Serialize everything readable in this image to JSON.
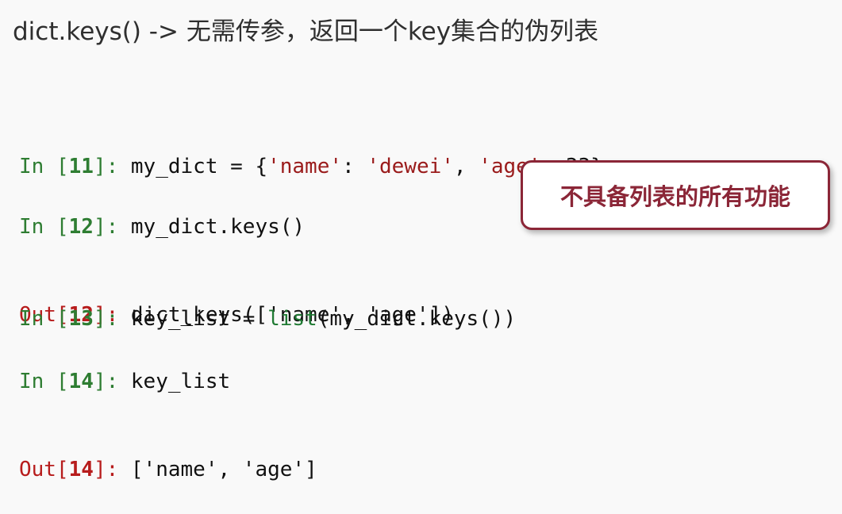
{
  "slide": {
    "title": "dict.keys()  -> 无需传参，返回一个key集合的伪列表"
  },
  "cells": [
    {
      "in_label": "In [",
      "in_num": "11",
      "in_close": "]: ",
      "code": [
        {
          "text": "my_dict = {",
          "kind": "txt"
        },
        {
          "text": "'name'",
          "kind": "str"
        },
        {
          "text": ": ",
          "kind": "txt"
        },
        {
          "text": "'dewei'",
          "kind": "str"
        },
        {
          "text": ", ",
          "kind": "txt"
        },
        {
          "text": "'age'",
          "kind": "str"
        },
        {
          "text": ": 33}",
          "kind": "txt"
        }
      ]
    },
    {
      "in_label": "In [",
      "in_num": "12",
      "in_close": "]: ",
      "code": [
        {
          "text": "my_dict.keys()",
          "kind": "txt"
        }
      ],
      "out_label": "Out[",
      "out_num": "12",
      "out_close": "]: ",
      "output": "dict_keys(['name', 'age'])"
    },
    {
      "in_label": "In [",
      "in_num": "13",
      "in_close": "]: ",
      "code": [
        {
          "text": "key_list = ",
          "kind": "txt"
        },
        {
          "text": "list",
          "kind": "bi"
        },
        {
          "text": "(my_dict.keys())",
          "kind": "txt"
        }
      ]
    },
    {
      "in_label": "In [",
      "in_num": "14",
      "in_close": "]: ",
      "code": [
        {
          "text": "key_list",
          "kind": "txt"
        }
      ],
      "out_label": "Out[",
      "out_num": "14",
      "out_close": "]: ",
      "output": "['name', 'age']"
    }
  ],
  "callout": {
    "text": "不具备列表的所有功能",
    "border_color": "#8b2637"
  }
}
